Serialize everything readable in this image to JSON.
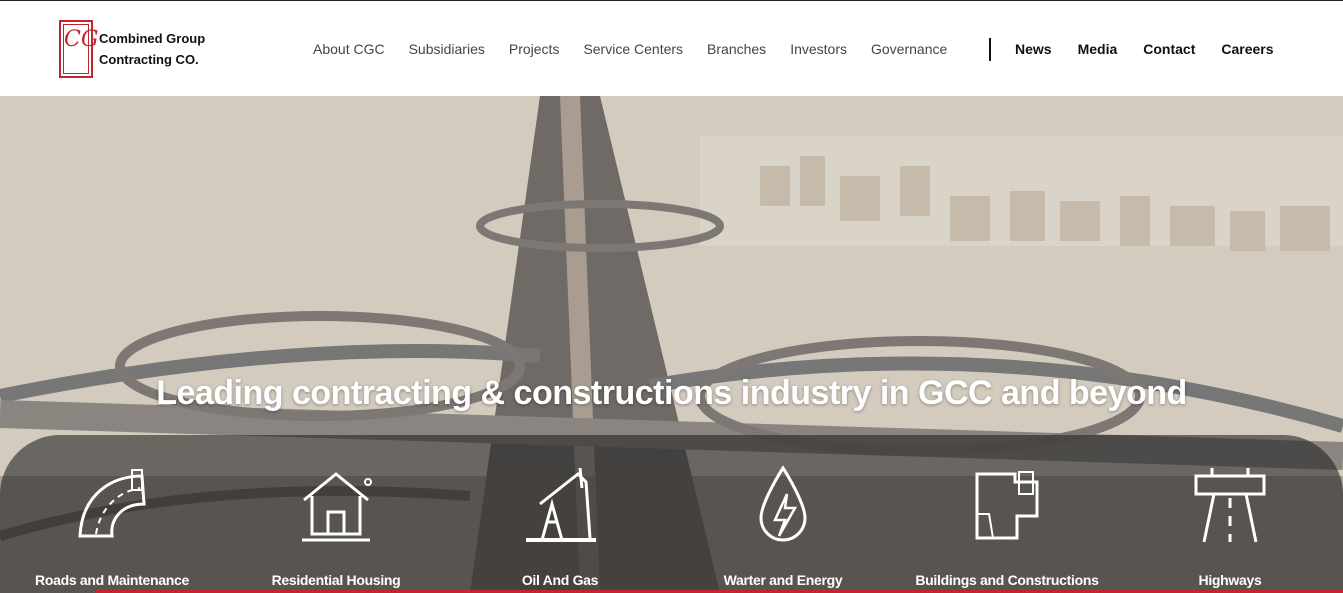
{
  "brand": {
    "line1": "Combined Group",
    "line2": "Contracting CO.",
    "mark": "CG",
    "accent_color": "#c0282d"
  },
  "nav": {
    "primary": [
      "About CGC",
      "Subsidiaries",
      "Projects",
      "Service Centers",
      "Branches",
      "Investors",
      "Governance"
    ],
    "secondary": [
      "News",
      "Media",
      "Contact",
      "Careers"
    ]
  },
  "hero": {
    "headline": "Leading contracting & constructions industry in GCC and beyond"
  },
  "services": [
    {
      "label": "Roads and Maintenance",
      "icon": "road-icon"
    },
    {
      "label": "Residential Housing",
      "icon": "house-icon"
    },
    {
      "label": "Oil And Gas",
      "icon": "oil-pump-icon"
    },
    {
      "label": "Warter and Energy",
      "icon": "water-energy-icon"
    },
    {
      "label": "Buildings and Constructions",
      "icon": "blueprint-icon"
    },
    {
      "label": "Highways",
      "icon": "highway-icon"
    }
  ]
}
